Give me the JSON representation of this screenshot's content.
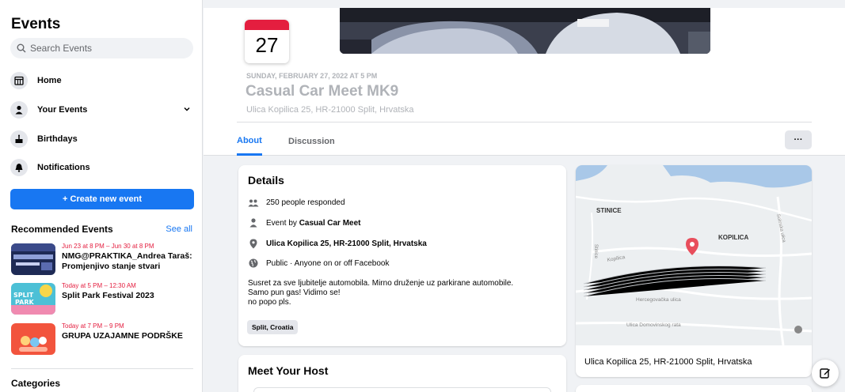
{
  "sidebar": {
    "title": "Events",
    "search_placeholder": "Search Events",
    "nav": [
      {
        "label": "Home",
        "icon": "calendar-grid-icon"
      },
      {
        "label": "Your Events",
        "icon": "person-icon"
      },
      {
        "label": "Birthdays",
        "icon": "cake-icon"
      },
      {
        "label": "Notifications",
        "icon": "bell-icon"
      }
    ],
    "create_button": "+ Create new event",
    "recommended_title": "Recommended Events",
    "see_all": "See all",
    "recommended": [
      {
        "date": "Jun 23 at 8 PM – Jun 30 at 8 PM",
        "title": "NMG@PRAKTIKA_Andrea Taraš: Promjenjivo stanje stvari"
      },
      {
        "date": "Today at 5 PM – 12:30 AM",
        "title": "Split Park Festival 2023"
      },
      {
        "date": "Today at 7 PM – 9 PM",
        "title": "GRUPA UZAJAMNE PODRŠKE"
      }
    ],
    "categories": "Categories"
  },
  "event": {
    "day": "27",
    "date_line": "SUNDAY, FEBRUARY 27, 2022 AT 5 PM",
    "title": "Casual Car Meet MK9",
    "location": "Ulica Kopilica 25, HR-21000 Split, Hrvatska",
    "tabs": [
      "About",
      "Discussion"
    ],
    "more": "···"
  },
  "details": {
    "title": "Details",
    "responded": "250 people responded",
    "event_by_prefix": "Event by ",
    "event_by": "Casual Car Meet",
    "address": "Ulica Kopilica 25, HR-21000 Split, Hrvatska",
    "privacy": "Public · Anyone on or off Facebook",
    "description": [
      "Susret za sve ljubitelje automobila. Mirno druženje uz parkirane automobile.",
      "Samo pun gas! Vidimo se!",
      "no popo pls."
    ],
    "chip": "Split, Croatia"
  },
  "host": {
    "title": "Meet Your Host"
  },
  "map": {
    "address": "Ulica Kopilica 25, HR-21000 Split, Hrvatska",
    "labels": {
      "stinice": "STINICE",
      "kopilica": "KOPILICA",
      "kopilica_street": "Kopilica",
      "hercegovacka": "Hercegovačka ulica",
      "domovinskog": "Ulica Domovinskog rata",
      "stinice_street": "Stinice",
      "solinska": "Solinska ulica"
    }
  },
  "colors": {
    "accent": "#1877f2",
    "date_red": "#e41e3f",
    "pin": "#e84e5c"
  }
}
